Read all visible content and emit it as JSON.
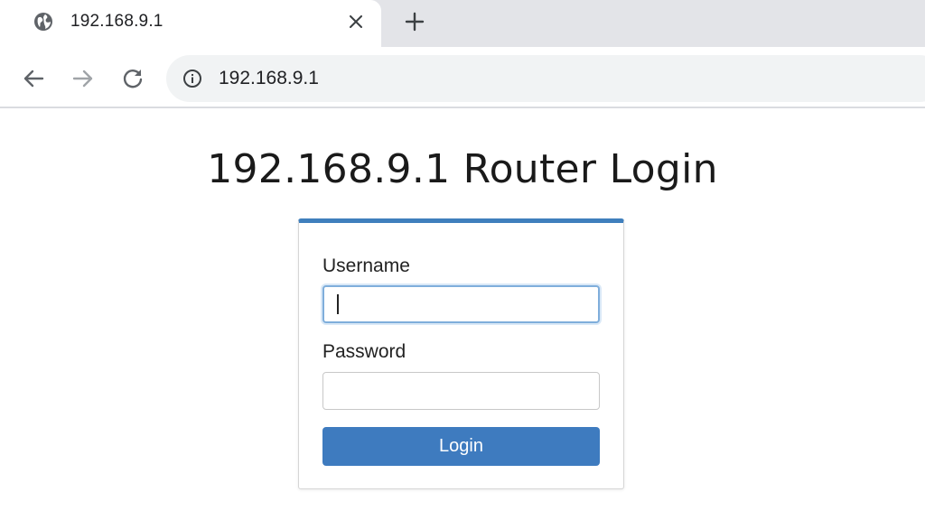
{
  "browser": {
    "tab": {
      "title": "192.168.9.1",
      "favicon": "globe-icon"
    },
    "omnibox": {
      "url": "192.168.9.1",
      "icon": "info-icon"
    }
  },
  "page": {
    "title": "192.168.9.1 Router Login",
    "form": {
      "username_label": "Username",
      "username_value": "",
      "password_label": "Password",
      "password_value": "",
      "login_label": "Login"
    }
  },
  "colors": {
    "accent": "#3e7bbf",
    "card_top_border": "#3f7fbd",
    "tabstrip_bg": "#e3e4e8",
    "omnibox_bg": "#f1f3f4"
  }
}
